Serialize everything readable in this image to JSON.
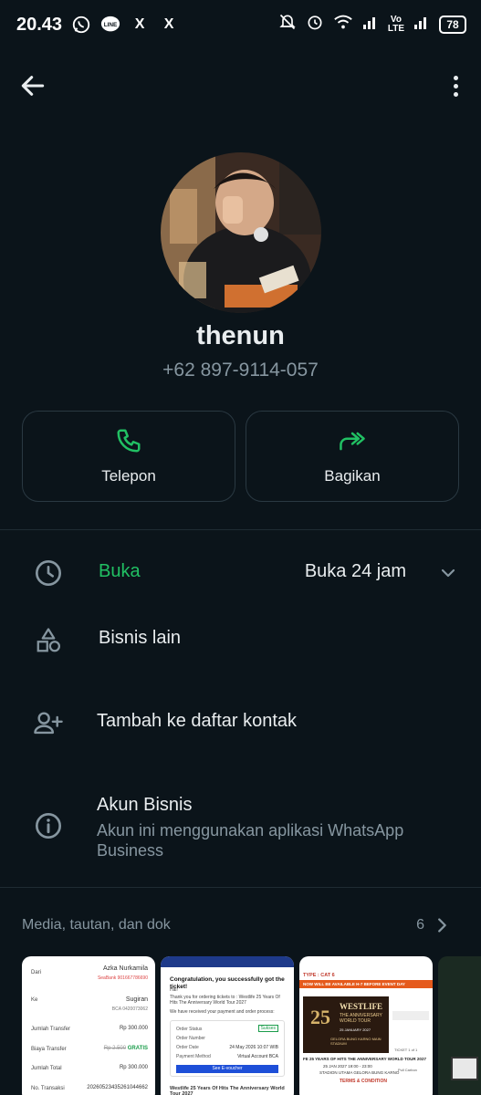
{
  "status_bar": {
    "time": "20.43",
    "left_icons": [
      "whatsapp-icon",
      "line-icon",
      "x-icon",
      "x-icon"
    ],
    "line_label": "LINE",
    "x_label": "X",
    "network": {
      "vo": "Vo",
      "lte": "LTE"
    },
    "battery": "78"
  },
  "contact": {
    "name": "thenun",
    "phone": "+62 897-9114-057"
  },
  "actions": {
    "call_label": "Telepon",
    "share_label": "Bagikan"
  },
  "hours": {
    "status": "Buka",
    "value": "Buka 24 jam"
  },
  "rows": {
    "other_business": "Bisnis lain",
    "add_contact": "Tambah ke daftar kontak",
    "business_account_title": "Akun Bisnis",
    "business_account_desc": "Akun ini menggunakan aplikasi WhatsApp Business"
  },
  "media": {
    "title": "Media, tautan, dan dok",
    "count": "6"
  },
  "thumb1": {
    "dari": "Dari",
    "from_name": "Azka Nurkamila",
    "from_acct": "SeaBank 901667786690",
    "ke": "Ke",
    "to_name": "Sugiran",
    "to_acct": "BCA 0420073062",
    "jumlah_transfer": "Jumlah Transfer",
    "jumlah_transfer_val": "Rp 300.000",
    "biaya_transfer": "Biaya Transfer",
    "biaya_old": "Rp 2.500",
    "biaya_val": "GRATIS",
    "jumlah_total": "Jumlah Total",
    "jumlah_total_val": "Rp 300.000",
    "no_transaksi": "No. Transaksi",
    "no_transaksi_val": "20260523435261044662"
  },
  "thumb2": {
    "congrats": "Congratulation, you successfully got the ticket!",
    "hi": "Hai!",
    "body": "Thank you for ordering tickets to : Westlife 25 Years Of Hits The Anniversary World Tour 2027",
    "body2": "We have received your payment and order process:",
    "order_status": "Order Status",
    "order_status_val": "Sukses",
    "order_number": "Order Number",
    "order_date": "Order Date",
    "order_date_val": "24 May 2026 10:07 WIB",
    "payment": "Payment Method",
    "payment_val": "Virtual Account BCA",
    "button": "See E-voucher",
    "footer": "Westlife 25 Years Of Hits The Anniversary World Tour 2027"
  },
  "thumb3": {
    "type": "TYPE : CAT 6",
    "available": "NOW WILL BE AVAILABLE H-7 BEFORE EVENT DAY",
    "poster_title": "WESTLIFE",
    "poster_sub": "THE ANNIVERSARY WORLD TOUR",
    "poster_num": "25",
    "poster_date": "25 JANUARY 2027",
    "poster_venue": "GELORA BUNG KARNO MAIN STADIUM",
    "desc": "FE 25 YEARS OF HITS THE ANNIVERSARY WORLD TOUR 2027",
    "desc2": "25 JAN 2027 19:00 - 23:00",
    "desc3": "STADION UTAMA GELORA BUNG KARNO",
    "terms": "TERMS & CONDITION",
    "ticket": "TICKET 1 of 1",
    "side": "Pull Carbon"
  },
  "colors": {
    "background": "#0b141a",
    "accent_green": "#21c063",
    "text_primary": "#e9edef",
    "text_secondary": "#8696a0",
    "border": "#2a3942"
  }
}
